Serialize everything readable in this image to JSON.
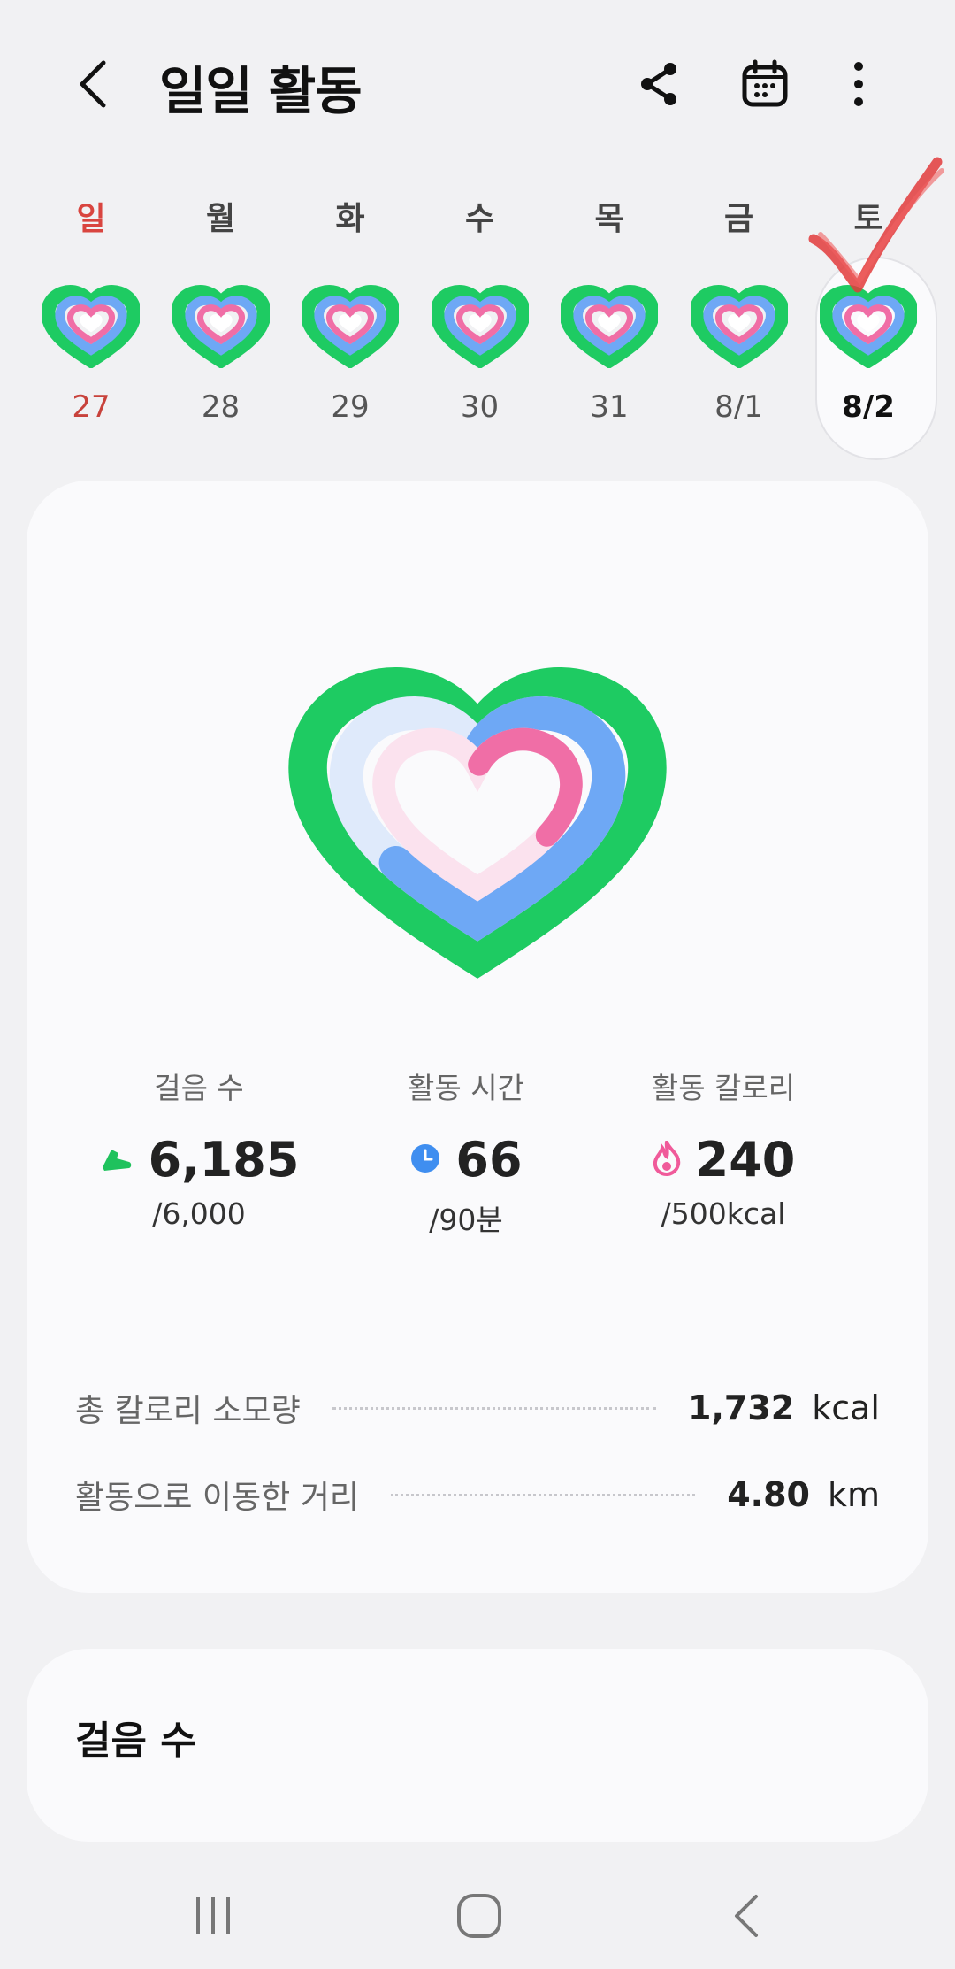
{
  "header": {
    "title": "일일 활동",
    "icons": [
      "back-icon",
      "share-icon",
      "calendar-icon",
      "more-icon"
    ]
  },
  "week": [
    {
      "name": "일",
      "date": "27"
    },
    {
      "name": "월",
      "date": "28"
    },
    {
      "name": "화",
      "date": "29"
    },
    {
      "name": "수",
      "date": "30"
    },
    {
      "name": "목",
      "date": "31"
    },
    {
      "name": "금",
      "date": "8/1"
    },
    {
      "name": "토",
      "date": "8/2"
    }
  ],
  "selected_day": "8/2",
  "stats": [
    {
      "label": "걸음 수",
      "value": "6,185",
      "goal": "/6,000",
      "icon": "shoe-icon",
      "color": "#1fc25d"
    },
    {
      "label": "활동 시간",
      "value": "66",
      "goal": "/90분",
      "icon": "clock-icon",
      "color": "#3f8ef0"
    },
    {
      "label": "활동 칼로리",
      "value": "240",
      "goal": "/500kcal",
      "icon": "flame-icon",
      "color": "#f05a9a"
    }
  ],
  "summary": [
    {
      "label": "총 칼로리 소모량",
      "value": "1,732",
      "unit": "kcal"
    },
    {
      "label": "활동으로 이동한 거리",
      "value": "4.80",
      "unit": "km"
    }
  ],
  "card2": {
    "title": "걸음 수"
  },
  "colors": {
    "steps_ring": "#1ecb62",
    "active_time_ring": "#6ea8f5",
    "calorie_ring": "#f06ea6",
    "sunday": "#d9453f",
    "background": "#f1f1f3",
    "card": "#fafafc"
  },
  "nav": [
    "recents-icon",
    "home-icon",
    "back-nav-icon"
  ]
}
